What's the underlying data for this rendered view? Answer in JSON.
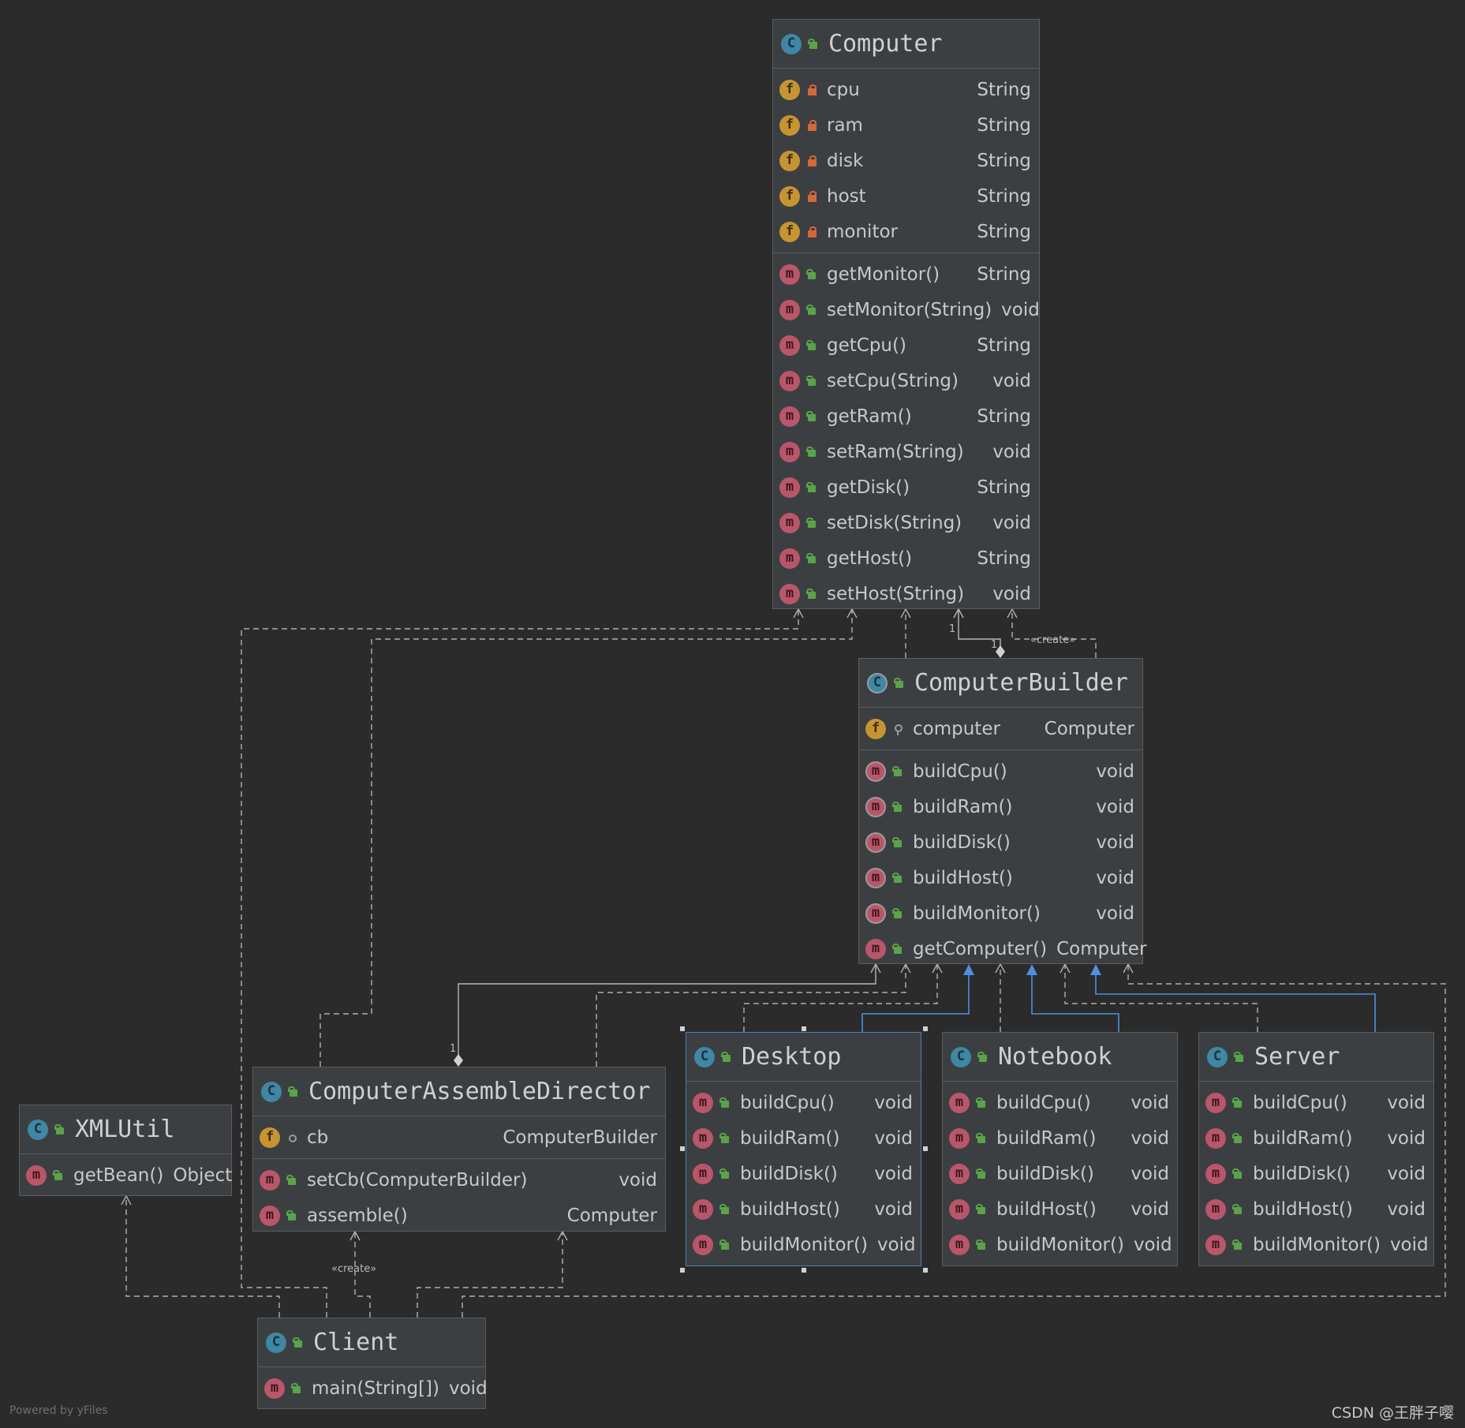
{
  "classes": {
    "computer": {
      "name": "Computer",
      "fields": [
        {
          "name": "cpu",
          "type": "String"
        },
        {
          "name": "ram",
          "type": "String"
        },
        {
          "name": "disk",
          "type": "String"
        },
        {
          "name": "host",
          "type": "String"
        },
        {
          "name": "monitor",
          "type": "String"
        }
      ],
      "methods": [
        {
          "name": "getMonitor()",
          "type": "String"
        },
        {
          "name": "setMonitor(String)",
          "type": "void"
        },
        {
          "name": "getCpu()",
          "type": "String"
        },
        {
          "name": "setCpu(String)",
          "type": "void"
        },
        {
          "name": "getRam()",
          "type": "String"
        },
        {
          "name": "setRam(String)",
          "type": "void"
        },
        {
          "name": "getDisk()",
          "type": "String"
        },
        {
          "name": "setDisk(String)",
          "type": "void"
        },
        {
          "name": "getHost()",
          "type": "String"
        },
        {
          "name": "setHost(String)",
          "type": "void"
        }
      ]
    },
    "computer_builder": {
      "name": "ComputerBuilder",
      "fields": [
        {
          "name": "computer",
          "type": "Computer"
        }
      ],
      "methods": [
        {
          "name": "buildCpu()",
          "type": "void"
        },
        {
          "name": "buildRam()",
          "type": "void"
        },
        {
          "name": "buildDisk()",
          "type": "void"
        },
        {
          "name": "buildHost()",
          "type": "void"
        },
        {
          "name": "buildMonitor()",
          "type": "void"
        },
        {
          "name": "getComputer()",
          "type": "Computer"
        }
      ]
    },
    "director": {
      "name": "ComputerAssembleDirector",
      "fields": [
        {
          "name": "cb",
          "type": "ComputerBuilder"
        }
      ],
      "methods": [
        {
          "name": "setCb(ComputerBuilder)",
          "type": "void"
        },
        {
          "name": "assemble()",
          "type": "Computer"
        }
      ]
    },
    "xmlutil": {
      "name": "XMLUtil",
      "methods": [
        {
          "name": "getBean()",
          "type": "Object"
        }
      ]
    },
    "desktop": {
      "name": "Desktop",
      "methods": [
        {
          "name": "buildCpu()",
          "type": "void"
        },
        {
          "name": "buildRam()",
          "type": "void"
        },
        {
          "name": "buildDisk()",
          "type": "void"
        },
        {
          "name": "buildHost()",
          "type": "void"
        },
        {
          "name": "buildMonitor()",
          "type": "void"
        }
      ]
    },
    "notebook": {
      "name": "Notebook",
      "methods": [
        {
          "name": "buildCpu()",
          "type": "void"
        },
        {
          "name": "buildRam()",
          "type": "void"
        },
        {
          "name": "buildDisk()",
          "type": "void"
        },
        {
          "name": "buildHost()",
          "type": "void"
        },
        {
          "name": "buildMonitor()",
          "type": "void"
        }
      ]
    },
    "server": {
      "name": "Server",
      "methods": [
        {
          "name": "buildCpu()",
          "type": "void"
        },
        {
          "name": "buildRam()",
          "type": "void"
        },
        {
          "name": "buildDisk()",
          "type": "void"
        },
        {
          "name": "buildHost()",
          "type": "void"
        },
        {
          "name": "buildMonitor()",
          "type": "void"
        }
      ]
    },
    "client": {
      "name": "Client",
      "methods": [
        {
          "name": "main(String[])",
          "type": "void"
        }
      ]
    }
  },
  "icons": {
    "class": "C",
    "field": "f",
    "method": "m"
  },
  "edge_labels": {
    "create_top": "«create»",
    "create_bottom": "«create»",
    "mult_a": "1",
    "mult_b": "1",
    "mult_c": "1"
  },
  "footer": {
    "powered_by": "Powered by yFiles",
    "watermark": "CSDN @王胖子嘤"
  },
  "colors": {
    "background": "#2b2b2b",
    "class_fill": "#3c3f41",
    "dependency_line": "#b0b0b0",
    "inheritance_line": "#4d8fe0"
  }
}
